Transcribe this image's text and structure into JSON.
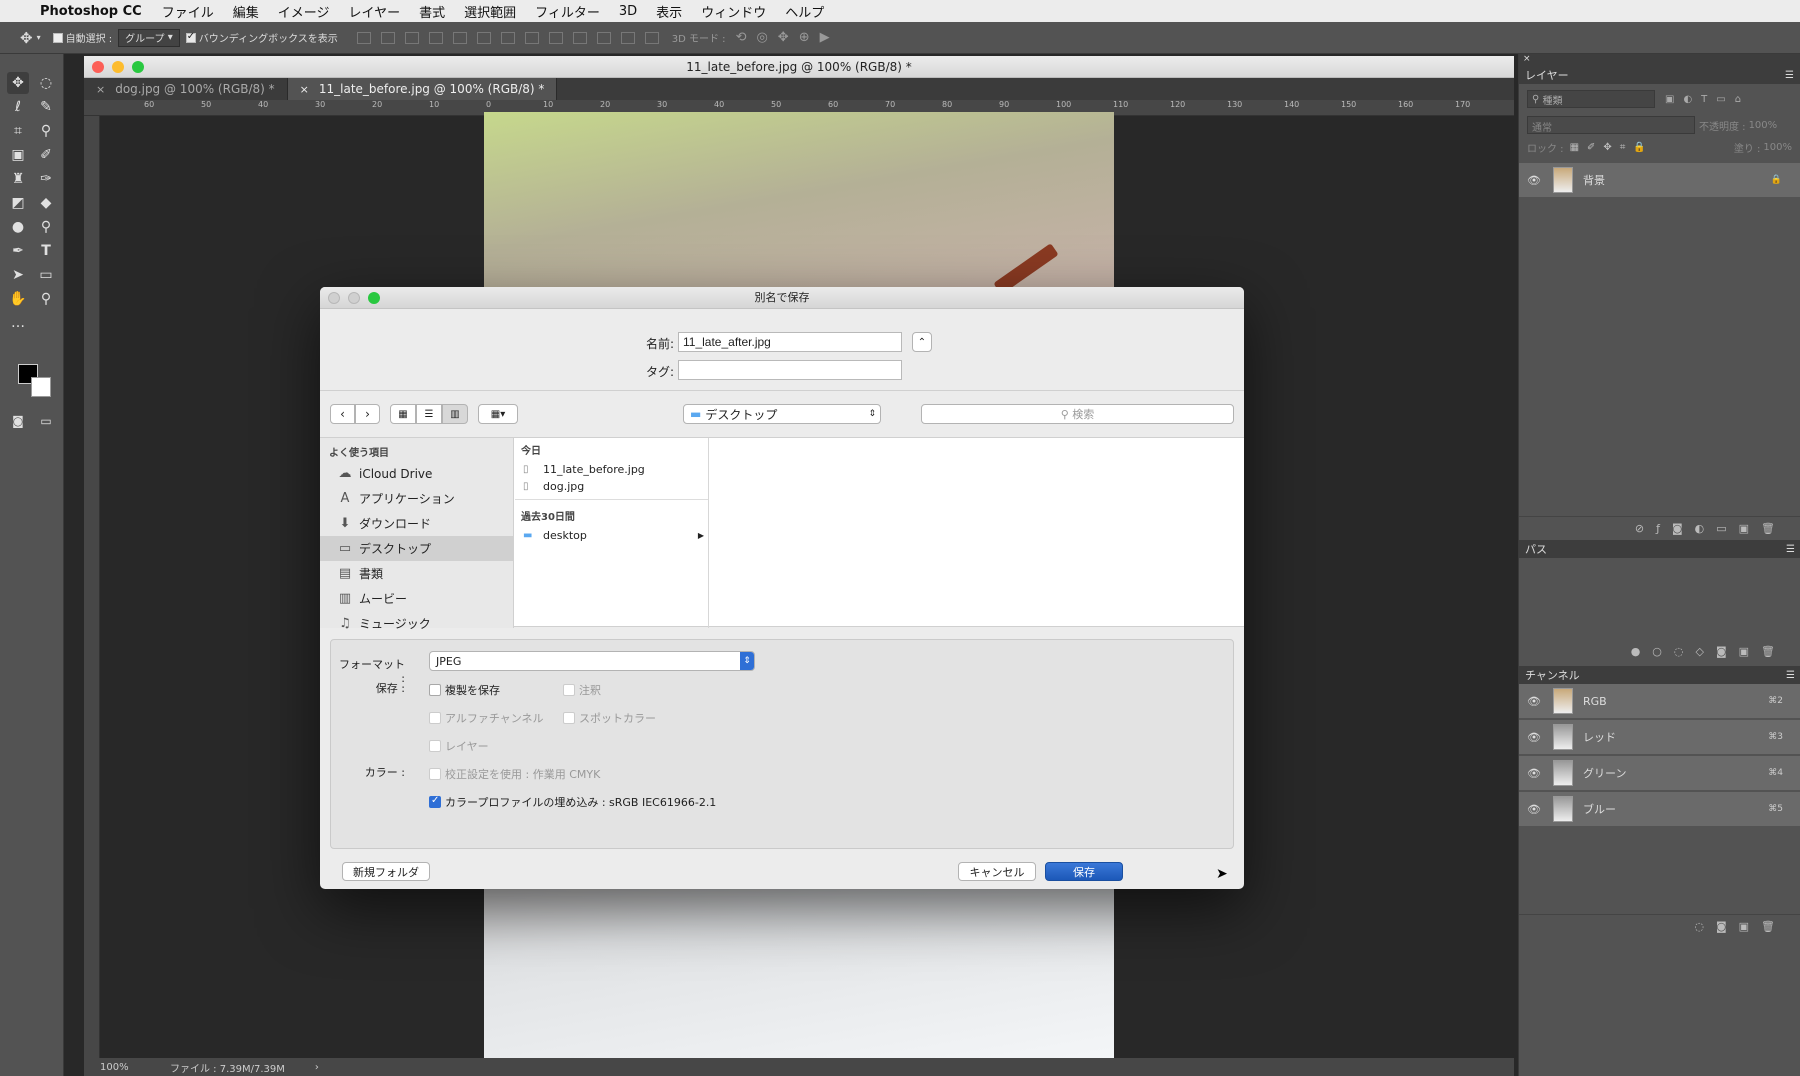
{
  "menubar": {
    "apple": "",
    "app": "Photoshop CC",
    "items": [
      "ファイル",
      "編集",
      "イメージ",
      "レイヤー",
      "書式",
      "選択範囲",
      "フィルター",
      "3D",
      "表示",
      "ウィンドウ",
      "ヘルプ"
    ]
  },
  "options_bar": {
    "auto_select_label": "自動選択 :",
    "auto_select_value": "グループ",
    "bounding_box_label": "バウンディングボックスを表示",
    "mode_3d_label": "3D モード :"
  },
  "document": {
    "window_title": "11_late_before.jpg @ 100% (RGB/8) *",
    "tabs": [
      {
        "label": "dog.jpg @ 100% (RGB/8) *"
      },
      {
        "label": "11_late_before.jpg @ 100% (RGB/8) *"
      }
    ],
    "ruler_h": [
      "60",
      "50",
      "40",
      "30",
      "20",
      "10",
      "0",
      "10",
      "20",
      "30",
      "40",
      "50",
      "60",
      "70",
      "80",
      "90",
      "100",
      "110",
      "120",
      "130",
      "140",
      "150",
      "160",
      "170"
    ],
    "zoom": "100%",
    "file_info": "ファイル : 7.39M/7.39M"
  },
  "layers_panel": {
    "tab": "レイヤー",
    "search_placeholder": "種類",
    "blend_mode": "通常",
    "opacity_label": "不透明度 :",
    "opacity_value": "100%",
    "lock_label": "ロック :",
    "fill_label": "塗り :",
    "fill_value": "100%",
    "layers": [
      {
        "name": "背景"
      }
    ]
  },
  "paths_panel": {
    "tab": "パス"
  },
  "channels_panel": {
    "tab": "チャンネル",
    "channels": [
      {
        "name": "RGB",
        "shortcut": "⌘2"
      },
      {
        "name": "レッド",
        "shortcut": "⌘3"
      },
      {
        "name": "グリーン",
        "shortcut": "⌘4"
      },
      {
        "name": "ブルー",
        "shortcut": "⌘5"
      }
    ]
  },
  "dialog": {
    "title": "別名で保存",
    "name_label": "名前:",
    "name_value": "11_late_after.jpg",
    "tag_label": "タグ:",
    "tag_value": "",
    "location": "デスクトップ",
    "search_placeholder": "検索",
    "sidebar_heading": "よく使う項目",
    "sidebar_items": [
      {
        "label": "iCloud Drive"
      },
      {
        "label": "アプリケーション"
      },
      {
        "label": "ダウンロード"
      },
      {
        "label": "デスクトップ"
      },
      {
        "label": "書類"
      },
      {
        "label": "ムービー"
      },
      {
        "label": "ミュージック"
      }
    ],
    "today_heading": "今日",
    "today_files": [
      "11_late_before.jpg",
      "dog.jpg"
    ],
    "past30_heading": "過去30日間",
    "past30_folder": "desktop",
    "format_label": "フォーマット :",
    "format_value": "JPEG",
    "save_label": "保存 :",
    "color_label": "カラー :",
    "opt_copy": "複製を保存",
    "opt_notes": "注釈",
    "opt_alpha": "アルファチャンネル",
    "opt_spot": "スポットカラー",
    "opt_layers": "レイヤー",
    "opt_proof": "校正設定を使用 : 作業用 CMYK",
    "opt_icc": "カラープロファイルの埋め込み : sRGB IEC61966-2.1",
    "new_folder": "新規フォルダ",
    "cancel": "キャンセル",
    "save": "保存"
  }
}
